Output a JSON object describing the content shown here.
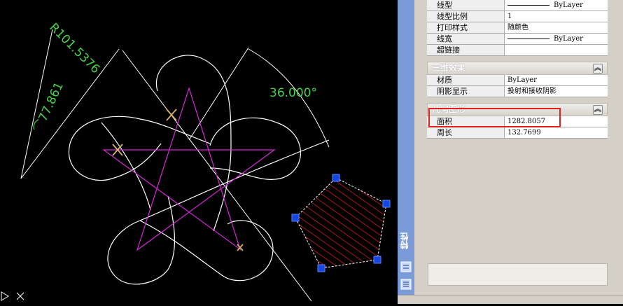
{
  "canvas": {
    "dims": {
      "radius": "R101.5376",
      "arc": "77.861",
      "arc_prefix": "⌒",
      "angle": "36.000°"
    },
    "colors": {
      "background": "#000000",
      "geometry": "#ffffff",
      "star": "#d828d8",
      "dimension": "#4ad04a",
      "hatch": "#e02020",
      "grip": "#1448e0"
    },
    "ucs_icon": "ucs-icon"
  },
  "palette": {
    "title": "特性",
    "rows_top": [
      {
        "label": "线型",
        "value": "ByLayer",
        "line_sample": true
      },
      {
        "label": "线型比例",
        "value": "1",
        "line_sample": false
      },
      {
        "label": "打印样式",
        "value": "随颜色",
        "line_sample": false
      },
      {
        "label": "线宽",
        "value": "ByLayer",
        "line_sample": true
      },
      {
        "label": "超链接",
        "value": "",
        "line_sample": false
      }
    ],
    "section_3d": {
      "title": "三维效果",
      "rows": [
        {
          "label": "材质",
          "value": "ByLayer"
        },
        {
          "label": "阴影显示",
          "value": "投射和接收阴影"
        }
      ]
    },
    "section_geom": {
      "title": "几何图形",
      "rows": [
        {
          "label": "面积",
          "value": "1282.8057"
        },
        {
          "label": "周长",
          "value": "132.7699"
        }
      ]
    }
  }
}
